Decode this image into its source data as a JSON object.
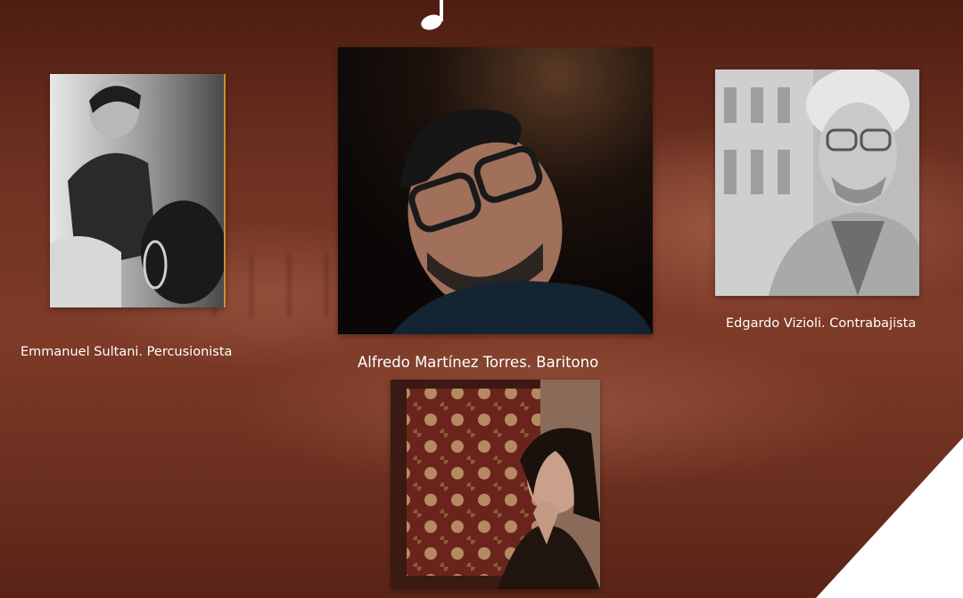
{
  "background": {
    "theme_colors": {
      "dark": "#4e1d12",
      "mid": "#7e3b28",
      "accent": "#ffffff"
    },
    "decor": [
      "music-note-icon",
      "piano-keys-background",
      "white-corner-triangle"
    ]
  },
  "musicians": [
    {
      "caption": "Emmanuel Sultani. Percusionista"
    },
    {
      "caption": "Alfredo Martínez Torres. Baritono"
    },
    {
      "caption": "Edgardo Vizioli. Contrabajista"
    },
    {
      "caption": ""
    }
  ]
}
